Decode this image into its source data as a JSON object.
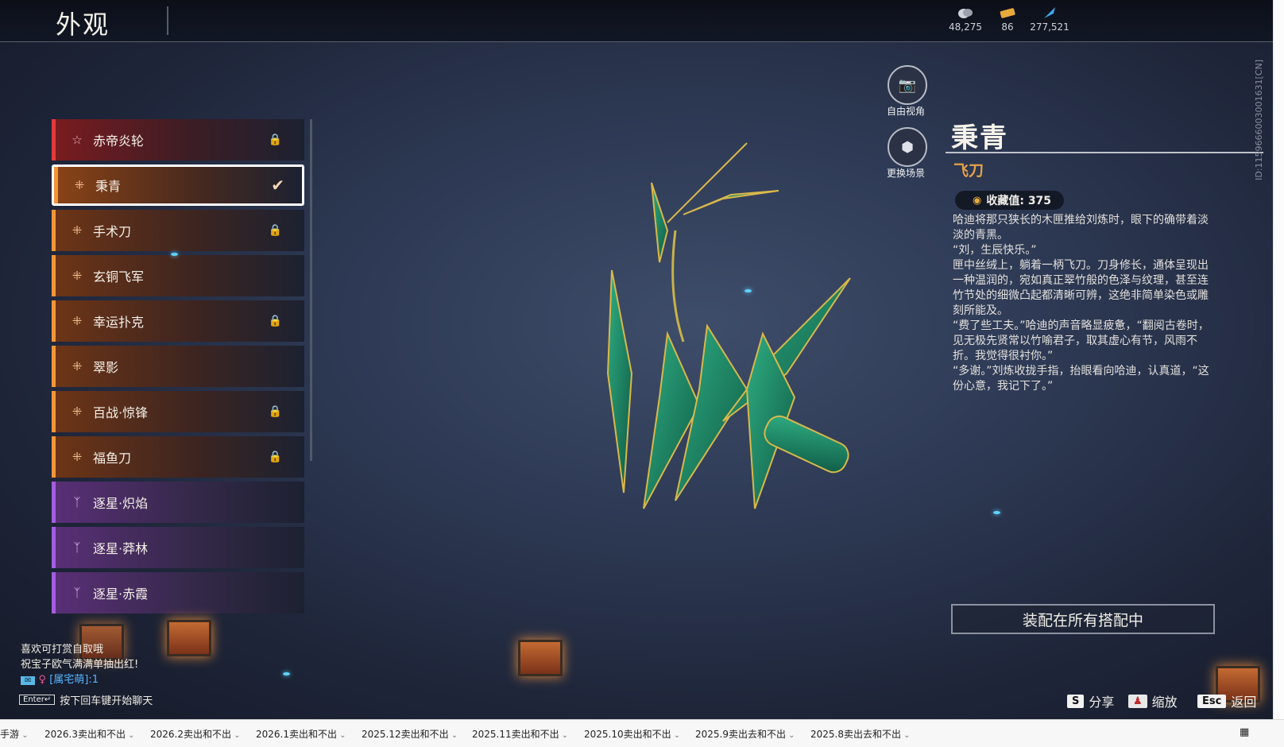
{
  "header": {
    "title": "外观"
  },
  "currencies": [
    {
      "icon": "coin-icon",
      "value": "48,275"
    },
    {
      "icon": "ticket-icon",
      "value": "86"
    },
    {
      "icon": "feather-icon",
      "value": "277,521"
    }
  ],
  "list": [
    {
      "label": "赤帝炎轮",
      "rarity": "red",
      "locked": true
    },
    {
      "label": "秉青",
      "rarity": "orange",
      "selected": true
    },
    {
      "label": "手术刀",
      "rarity": "orange",
      "locked": true
    },
    {
      "label": "玄铜飞军",
      "rarity": "orange"
    },
    {
      "label": "幸运扑克",
      "rarity": "orange",
      "locked": true
    },
    {
      "label": "翠影",
      "rarity": "orange"
    },
    {
      "label": "百战·惊锋",
      "rarity": "orange",
      "locked": true
    },
    {
      "label": "福鱼刀",
      "rarity": "orange",
      "locked": true
    },
    {
      "label": "逐星·炽焰",
      "rarity": "purple"
    },
    {
      "label": "逐星·莽林",
      "rarity": "purple"
    },
    {
      "label": "逐星·赤霞",
      "rarity": "purple"
    }
  ],
  "view": {
    "free_camera": "自由视角",
    "change_scene": "更换场景"
  },
  "detail": {
    "name": "秉青",
    "type": "飞刀",
    "collection": "收藏值: 375",
    "desc": [
      "哈迪将那只狭长的木匣推给刘炼时，眼下的确带着淡淡的青黑。",
      "“刘，生辰快乐。”",
      "匣中丝绒上，躺着一柄飞刀。刀身修长，通体呈现出一种温润的，宛如真正翠竹般的色泽与纹理，甚至连竹节处的细微凸起都清晰可辨，这绝非简单染色或雕刻所能及。",
      "“费了些工夫。”哈迪的声音略显疲惫，“翻阅古卷时，见无极先贤常以竹喻君子，取其虚心有节，风雨不折。我觉得很衬你。”",
      "“多谢。”刘炼收拢手指，抬眼看向哈迪，认真道，“这份心意，我记下了。”"
    ],
    "equip": "装配在所有搭配中",
    "side_id": "ID:1159666003001631[CN]"
  },
  "hints": [
    {
      "key": "S",
      "label": "分享"
    },
    {
      "key": "♟",
      "label": "缩放"
    },
    {
      "key": "Esc",
      "label": "返回"
    }
  ],
  "chat": {
    "line1": "喜欢可打赏自取哦",
    "line2": "祝宝子欧气满满单抽出红!",
    "player": "[属宅萌]:1",
    "enter": "按下回车键开始聊天",
    "enter_key": "Enter↵"
  },
  "tabs": [
    "手游",
    "2026.3卖出和不出",
    "2026.2卖出和不出",
    "2026.1卖出和不出",
    "2025.12卖出和不出",
    "2025.11卖出和不出",
    "2025.10卖出和不出",
    "2025.9卖出去和不出",
    "2025.8卖出去和不出"
  ]
}
